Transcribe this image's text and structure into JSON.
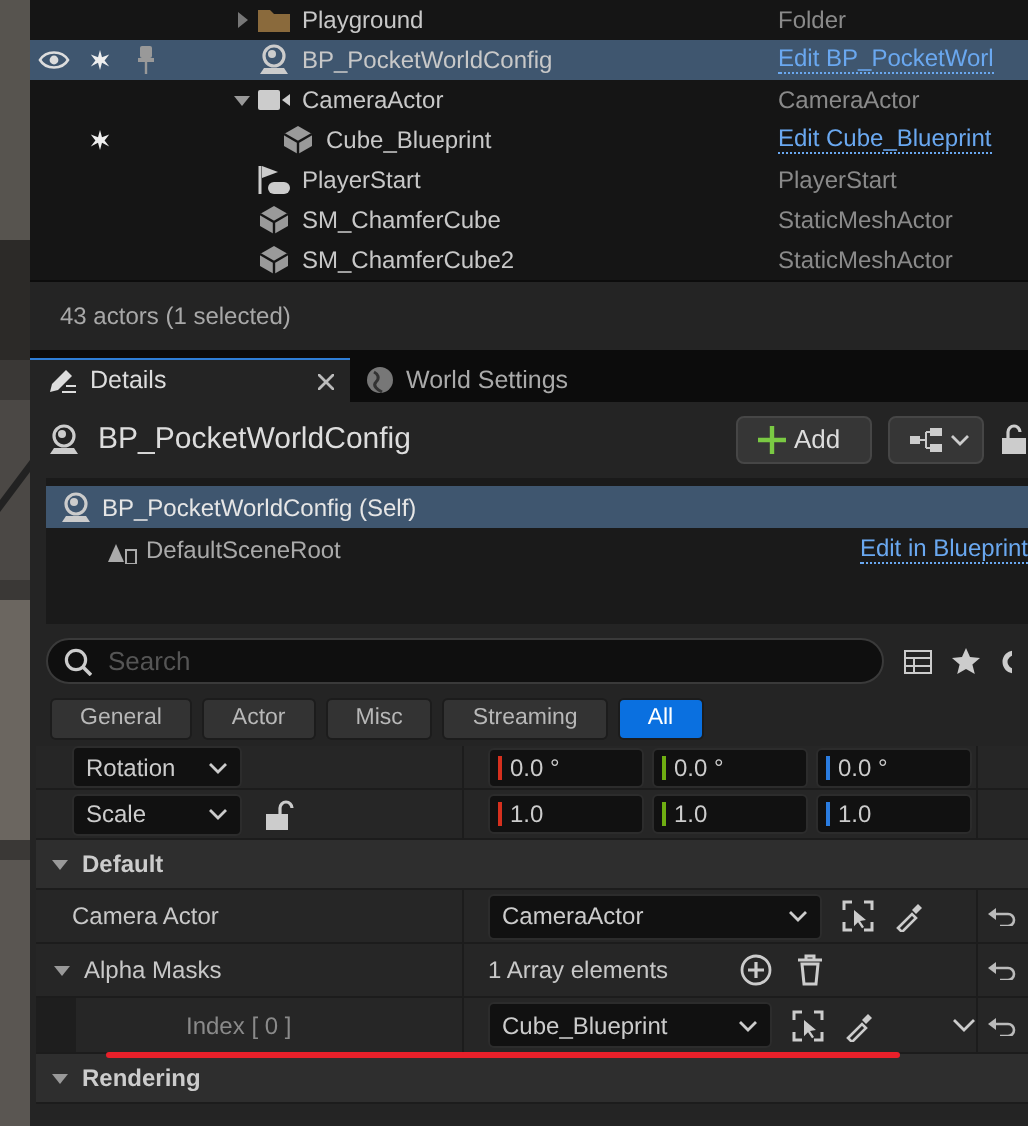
{
  "outliner": {
    "rows": [
      {
        "kind": "folder",
        "label": "Playground",
        "type": "Folder",
        "expanded": false,
        "selected": false,
        "visible": false,
        "starred": false,
        "pinned": false
      },
      {
        "kind": "actor",
        "label": "BP_PocketWorldConfig",
        "edit_link": "Edit BP_PocketWorl",
        "selected": true,
        "visible": true,
        "starred": true,
        "pinned": true
      },
      {
        "kind": "camera",
        "label": "CameraActor",
        "type": "CameraActor",
        "expanded": true,
        "selected": false,
        "visible": false,
        "starred": false,
        "pinned": false,
        "children": [
          {
            "kind": "mesh",
            "label": "Cube_Blueprint",
            "edit_link": "Edit Cube_Blueprint",
            "selected": false,
            "visible": false,
            "starred": true,
            "pinned": false
          }
        ]
      },
      {
        "kind": "player_start",
        "label": "PlayerStart",
        "type": "PlayerStart",
        "selected": false,
        "visible": false,
        "starred": false,
        "pinned": false
      },
      {
        "kind": "mesh",
        "label": "SM_ChamferCube",
        "type": "StaticMeshActor",
        "selected": false,
        "visible": false,
        "starred": false,
        "pinned": false
      },
      {
        "kind": "mesh",
        "label": "SM_ChamferCube2",
        "type": "StaticMeshActor",
        "selected": false,
        "visible": false,
        "starred": false,
        "pinned": false
      }
    ],
    "status": "43 actors (1 selected)"
  },
  "details": {
    "tabs": [
      {
        "label": "Details",
        "selected": true
      },
      {
        "label": "World Settings",
        "selected": false
      }
    ],
    "title": "BP_PocketWorldConfig",
    "add_button": "Add",
    "components": [
      {
        "label": "BP_PocketWorldConfig (Self)",
        "selected": true
      },
      {
        "label": "DefaultSceneRoot",
        "selected": false,
        "action": "Edit in Blueprint"
      }
    ],
    "search": {
      "placeholder": "Search"
    },
    "filters": [
      {
        "label": "General",
        "selected": false
      },
      {
        "label": "Actor",
        "selected": false
      },
      {
        "label": "Misc",
        "selected": false
      },
      {
        "label": "Streaming",
        "selected": false
      },
      {
        "label": "All",
        "selected": true
      }
    ],
    "properties": [
      {
        "kind": "vector",
        "label": "Rotation",
        "values": [
          "0.0 °",
          "0.0 °",
          "0.0 °"
        ]
      },
      {
        "kind": "vector",
        "label": "Scale",
        "locked": false,
        "values": [
          "1.0",
          "1.0",
          "1.0"
        ]
      },
      {
        "kind": "section",
        "label": "Default",
        "expanded": true
      },
      {
        "kind": "object",
        "label": "Camera Actor",
        "value": "CameraActor"
      },
      {
        "kind": "array",
        "label": "Alpha Masks",
        "expanded": true,
        "value": "1 Array elements"
      },
      {
        "kind": "element",
        "label": "Index [ 0 ]",
        "value": "Cube_Blueprint"
      },
      {
        "kind": "section",
        "label": "Rendering",
        "expanded": true
      }
    ]
  }
}
